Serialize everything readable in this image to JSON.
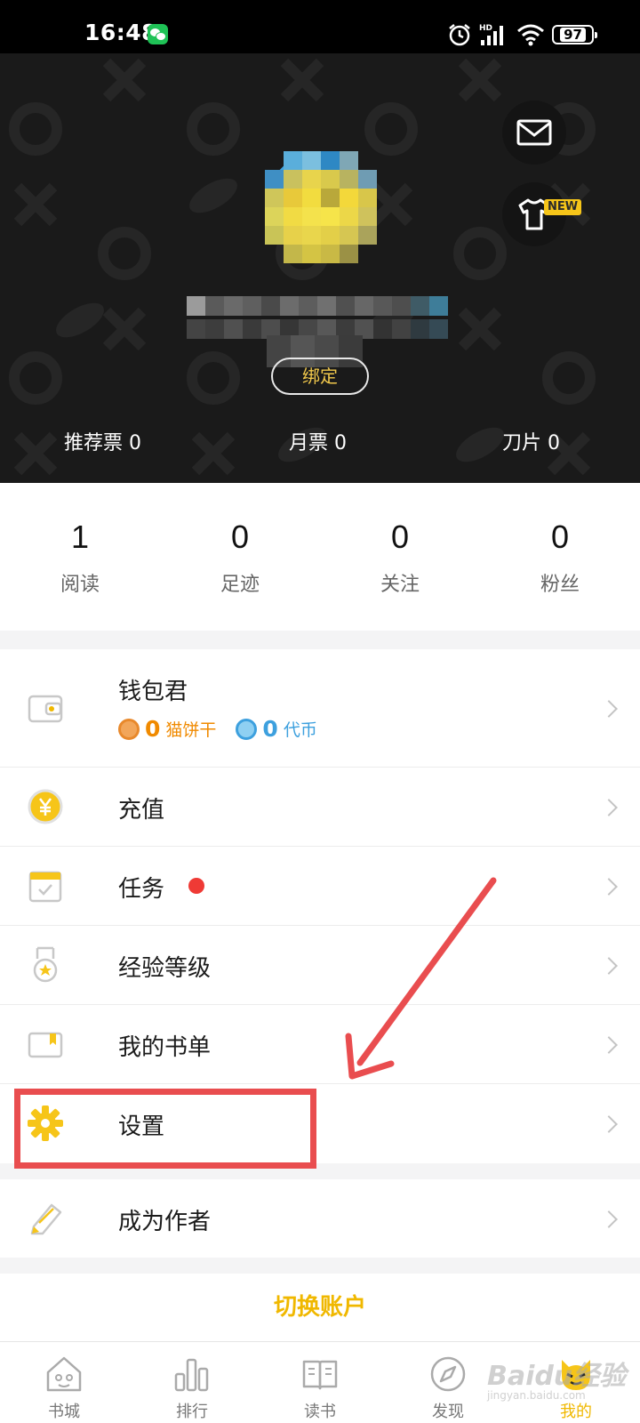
{
  "status_bar": {
    "time": "16:48",
    "network_label": "HD",
    "battery": "97"
  },
  "header": {
    "bind_button": "绑定",
    "tickets": [
      {
        "label": "推荐票",
        "value": "0"
      },
      {
        "label": "月票",
        "value": "0"
      },
      {
        "label": "刀片",
        "value": "0"
      }
    ],
    "new_badge": "NEW"
  },
  "stats": [
    {
      "value": "1",
      "label": "阅读"
    },
    {
      "value": "0",
      "label": "足迹"
    },
    {
      "value": "0",
      "label": "关注"
    },
    {
      "value": "0",
      "label": "粉丝"
    }
  ],
  "menu": {
    "wallet": {
      "label": "钱包君",
      "cookies_value": "0",
      "cookies_label": "猫饼干",
      "coins_value": "0",
      "coins_label": "代币"
    },
    "recharge": "充值",
    "tasks": "任务",
    "level": "经验等级",
    "booklist": "我的书单",
    "settings": "设置",
    "become_author": "成为作者"
  },
  "switch_account": "切换账户",
  "tabs": [
    {
      "label": "书城",
      "icon": "home-icon"
    },
    {
      "label": "排行",
      "icon": "bar-chart-icon"
    },
    {
      "label": "读书",
      "icon": "book-icon"
    },
    {
      "label": "发现",
      "icon": "compass-icon"
    },
    {
      "label": "我的",
      "icon": "cat-face-icon",
      "active": true
    }
  ],
  "colors": {
    "accent": "#f0b800",
    "cookie": "#f08a00",
    "coin": "#3da0de",
    "annotation": "#e94d4f"
  },
  "watermark": {
    "brand": "Baidu经验",
    "url": "jingyan.baidu.com"
  }
}
